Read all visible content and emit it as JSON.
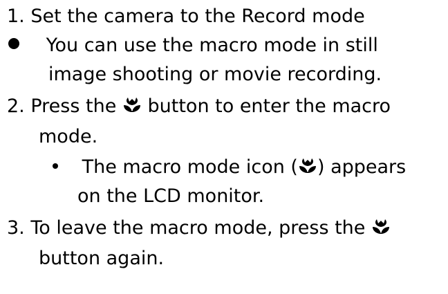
{
  "steps": [
    {
      "number": "1.",
      "text": "Set the camera to the Record mode"
    },
    {
      "bullet_text_line1": "You can use the macro mode in still",
      "bullet_text_line2": "image shooting or movie recording."
    },
    {
      "number": "2.",
      "text_before_icon": "Press the",
      "text_after_icon": "button to enter the macro",
      "text_line2": "mode.",
      "sub_bullet": {
        "text_before_icon": "The macro mode icon (",
        "text_after_icon": ") appears",
        "text_line2": "on the LCD monitor."
      }
    },
    {
      "number": "3.",
      "text_before_icon": "To leave the macro mode, press the",
      "text_line2": "button again."
    }
  ],
  "icons": {
    "macro": "macro-flower-icon",
    "bullet": "filled-circle-bullet"
  },
  "colors": {
    "text": "#000000",
    "background": "#ffffff"
  }
}
